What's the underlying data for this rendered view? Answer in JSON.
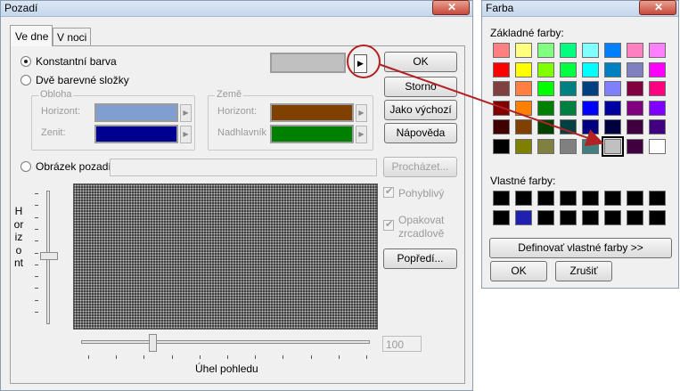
{
  "pozadi": {
    "title": "Pozadí",
    "tabs": [
      "Ve dne",
      "V noci"
    ],
    "radio_constant": "Konstantní barva",
    "radio_two": "Dvě barevné složky",
    "sky_group": "Obloha",
    "sky_horizon": "Horizont:",
    "sky_zenith": "Zenit:",
    "earth_group": "Země",
    "earth_horizon": "Horizont:",
    "earth_nadir": "Nadhlavník",
    "radio_image": "Obrázek pozadí",
    "browse": "Procházet...",
    "check_moving": "Pohyblivý",
    "check_mirror": "Opakovat zrcadlově",
    "foreground": "Popředí...",
    "ok": "OK",
    "cancel": "Storno",
    "default": "Jako výchozí",
    "help": "Nápověda",
    "horizon_vertical": "Horizont",
    "view_angle": "Úhel pohledu",
    "angle_value": "100",
    "slider_angle_fraction": 0.25,
    "colors": {
      "constant": "#c0c0c0",
      "sky_horizon": "#809fd0",
      "sky_zenith": "#000090",
      "earth_horizon": "#804000",
      "earth_nadir": "#008000",
      "highlight": "#b22222"
    }
  },
  "farba": {
    "title": "Farba",
    "basic_label": "Základné farby:",
    "custom_label": "Vlastné farby:",
    "define_button": "Definovať vlastné farby >>",
    "ok": "OK",
    "cancel": "Zrušiť",
    "basic_colors": [
      [
        "#ff8080",
        "#ffff80",
        "#80ff80",
        "#00ff80",
        "#80ffff",
        "#0080ff",
        "#ff80c0",
        "#ff80ff"
      ],
      [
        "#ff0000",
        "#ffff00",
        "#80ff00",
        "#00ff40",
        "#00ffff",
        "#0080c0",
        "#8080c0",
        "#ff00ff"
      ],
      [
        "#804040",
        "#ff8040",
        "#00ff00",
        "#008080",
        "#004080",
        "#8080ff",
        "#800040",
        "#ff0080"
      ],
      [
        "#800000",
        "#ff8000",
        "#008000",
        "#008040",
        "#0000ff",
        "#0000a0",
        "#800080",
        "#8000ff"
      ],
      [
        "#400000",
        "#804000",
        "#004000",
        "#004040",
        "#000080",
        "#000040",
        "#400040",
        "#400080"
      ],
      [
        "#000000",
        "#808000",
        "#808040",
        "#808080",
        "#408080",
        "#c0c0c0",
        "#400040",
        "#ffffff"
      ]
    ],
    "selected": [
      5,
      5
    ],
    "custom_colors": [
      [
        "#000000",
        "#000000",
        "#000000",
        "#000000",
        "#000000",
        "#000000",
        "#000000",
        "#000000"
      ],
      [
        "#000000",
        "#2020b0",
        "#000000",
        "#000000",
        "#000000",
        "#000000",
        "#000000",
        "#000000"
      ]
    ]
  }
}
